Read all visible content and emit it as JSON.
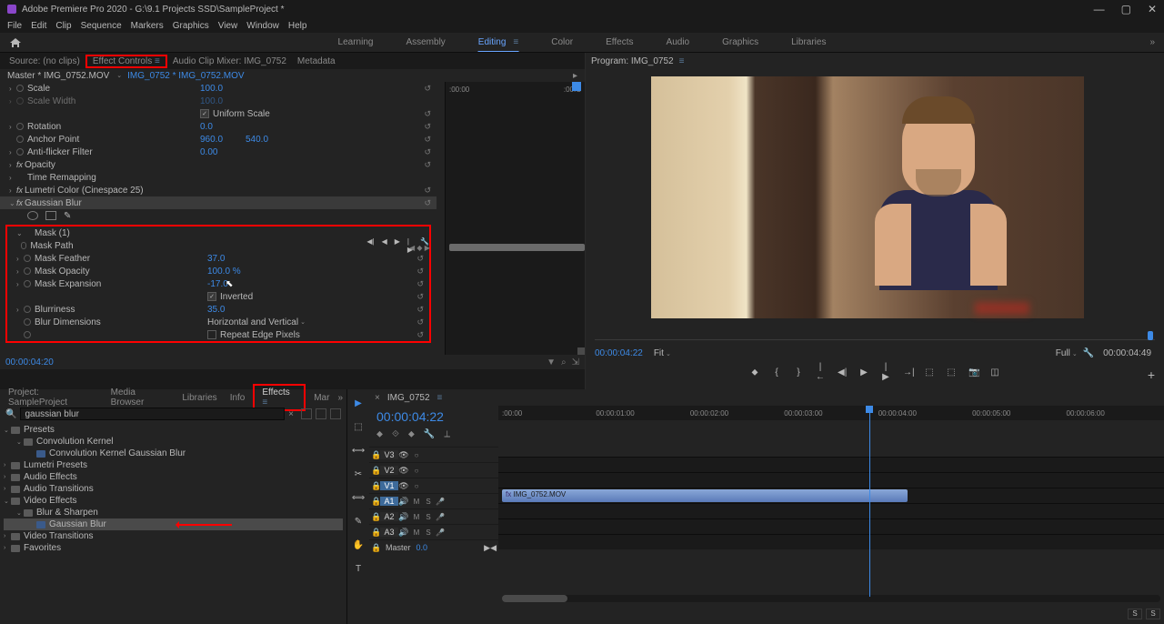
{
  "app": {
    "title": "Adobe Premiere Pro 2020 - G:\\9.1 Projects SSD\\SampleProject *"
  },
  "menu": [
    "File",
    "Edit",
    "Clip",
    "Sequence",
    "Markers",
    "Graphics",
    "View",
    "Window",
    "Help"
  ],
  "workspaces": {
    "items": [
      "Learning",
      "Assembly",
      "Editing",
      "Color",
      "Effects",
      "Audio",
      "Graphics",
      "Libraries"
    ],
    "active": "Editing"
  },
  "source_tabs": {
    "source": "Source: (no clips)",
    "effect_controls": "Effect Controls",
    "audio_mixer": "Audio Clip Mixer: IMG_0752",
    "metadata": "Metadata"
  },
  "effect_controls": {
    "master": "Master * IMG_0752.MOV",
    "clip_link": "IMG_0752 * IMG_0752.MOV",
    "timeline_labels": [
      ":00:00",
      ":00:C"
    ],
    "rows": {
      "scale": {
        "label": "Scale",
        "val": "100.0"
      },
      "scale_width": {
        "label": "Scale Width",
        "val": "100.0"
      },
      "uniform": {
        "label": "Uniform Scale",
        "checked": true
      },
      "rotation": {
        "label": "Rotation",
        "val": "0.0"
      },
      "anchor": {
        "label": "Anchor Point",
        "x": "960.0",
        "y": "540.0"
      },
      "antiflicker": {
        "label": "Anti-flicker Filter",
        "val": "0.00"
      },
      "opacity": "Opacity",
      "time_remap": "Time Remapping",
      "lumetri": "Lumetri Color (Cinespace 25)",
      "gaussian": "Gaussian Blur"
    },
    "mask": {
      "title": "Mask (1)",
      "path": "Mask Path",
      "feather": {
        "label": "Mask Feather",
        "val": "37.0"
      },
      "opacity": {
        "label": "Mask Opacity",
        "val": "100.0 %"
      },
      "expansion": {
        "label": "Mask Expansion",
        "val": "-17.0"
      },
      "inverted": {
        "label": "Inverted",
        "checked": true
      },
      "blurriness": {
        "label": "Blurriness",
        "val": "35.0"
      },
      "dimensions": {
        "label": "Blur Dimensions",
        "val": "Horizontal and Vertical"
      },
      "repeat": {
        "label": "Repeat Edge Pixels",
        "checked": false
      }
    },
    "timecode": "00:00:04:20"
  },
  "program": {
    "title": "Program: IMG_0752",
    "timecode": "00:00:04:22",
    "fit": "Fit",
    "scale": "Full",
    "duration": "00:00:04:49"
  },
  "project": {
    "tabs": [
      "Project: SampleProject",
      "Media Browser",
      "Libraries",
      "Info",
      "Effects",
      "Mar"
    ],
    "search": "gaussian blur",
    "tree": {
      "presets": "Presets",
      "conv_kernel": "Convolution Kernel",
      "conv_gaussian": "Convolution Kernel Gaussian Blur",
      "lumetri": "Lumetri Presets",
      "audio_fx": "Audio Effects",
      "audio_tr": "Audio Transitions",
      "video_fx": "Video Effects",
      "blur_sharpen": "Blur & Sharpen",
      "gaussian": "Gaussian Blur",
      "video_tr": "Video Transitions",
      "favorites": "Favorites"
    }
  },
  "timeline": {
    "seq_name": "IMG_0752",
    "timecode": "00:00:04:22",
    "ruler": [
      ":00:00",
      "00:00:01:00",
      "00:00:02:00",
      "00:00:03:00",
      "00:00:04:00",
      "00:00:05:00",
      "00:00:06:00"
    ],
    "tracks": {
      "v3": "V3",
      "v2": "V2",
      "v1": "V1",
      "a1": "A1",
      "a2": "A2",
      "a3": "A3",
      "master": "Master",
      "master_val": "0.0"
    },
    "clip_name": "IMG_0752.MOV",
    "snap_s": "S"
  }
}
